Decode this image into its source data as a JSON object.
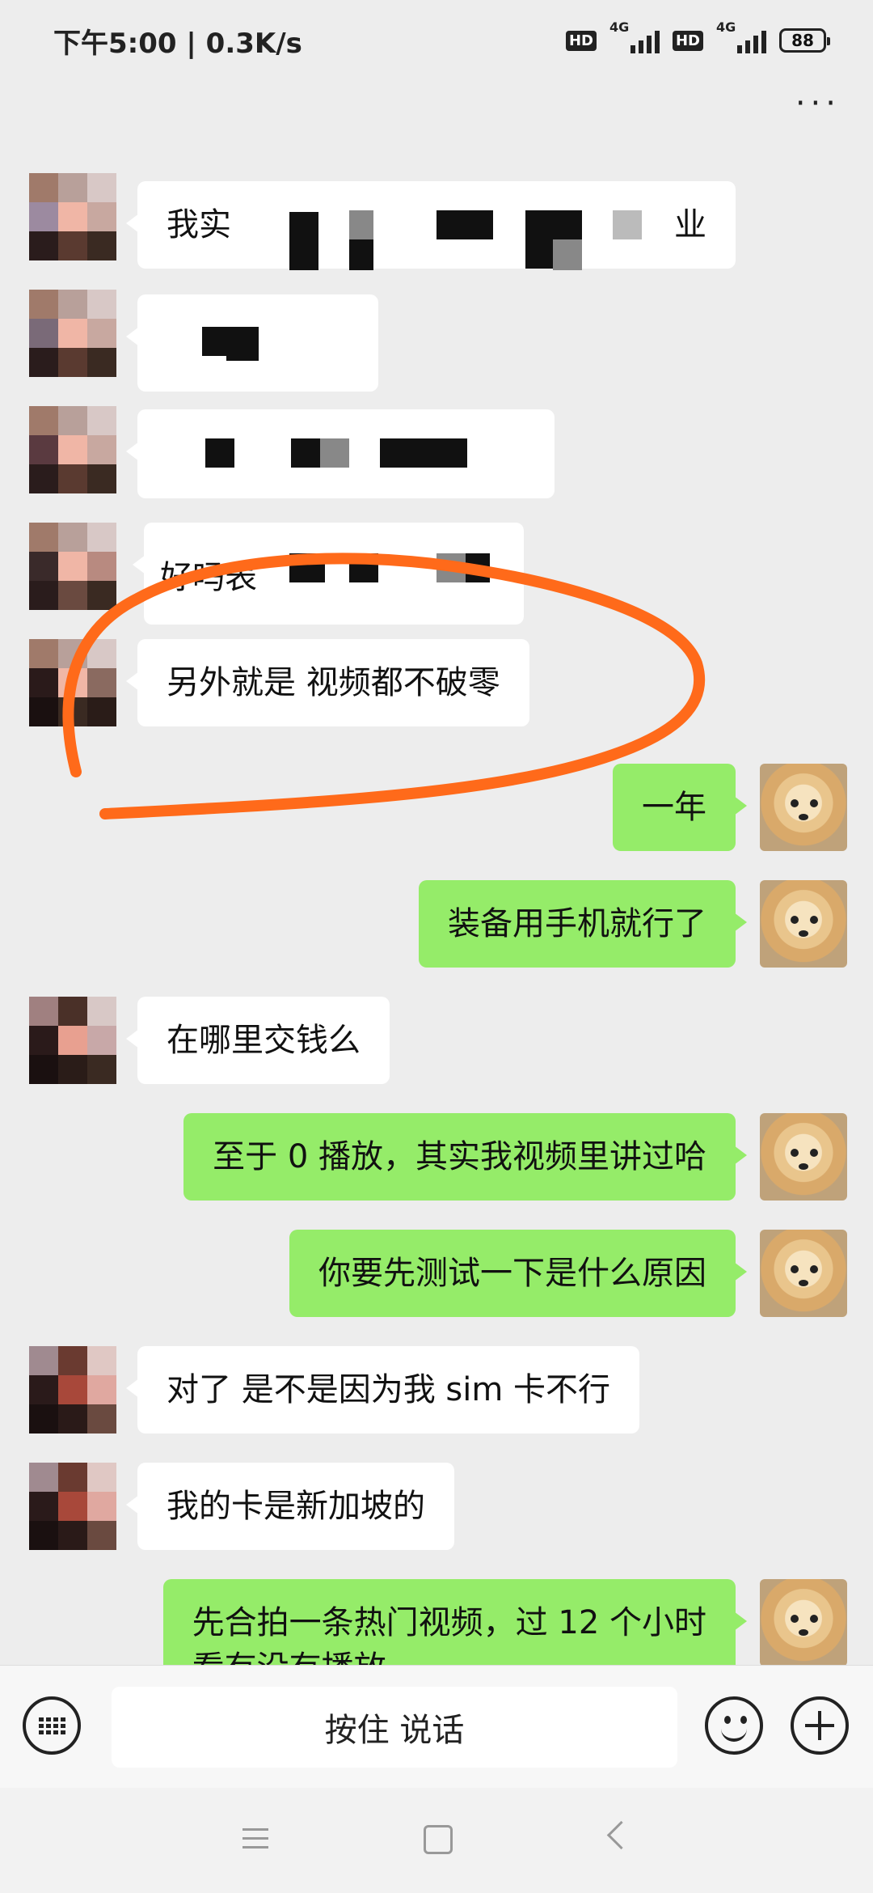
{
  "status_bar": {
    "time_speed": "下午5:00 | 0.3K/s",
    "hd_label": "HD",
    "network_label": "4G",
    "battery": "88"
  },
  "header": {
    "more_icon": "more-dots-icon",
    "more_glyph": "···"
  },
  "messages": [
    {
      "side": "in",
      "text": "我实",
      "suffix": "业",
      "redacted": true
    },
    {
      "side": "in",
      "text": "",
      "redacted": true
    },
    {
      "side": "in",
      "text": "",
      "redacted": true
    },
    {
      "side": "in",
      "text": "好吗表",
      "redacted": true
    },
    {
      "side": "in",
      "text": "另外就是 视频都不破零"
    },
    {
      "side": "out",
      "text": "一年"
    },
    {
      "side": "out",
      "text": "装备用手机就行了"
    },
    {
      "side": "in",
      "text": "在哪里交钱么"
    },
    {
      "side": "out",
      "text": "至于 0 播放，其实我视频里讲过哈"
    },
    {
      "side": "out",
      "text": "你要先测试一下是什么原因"
    },
    {
      "side": "in",
      "text": "对了 是不是因为我 sim 卡不行"
    },
    {
      "side": "in",
      "text": "我的卡是新加坡的"
    },
    {
      "side": "out",
      "text": "先合拍一条热门视频，过 12 个小时",
      "text2": "看有没有播放"
    }
  ],
  "input_bar": {
    "voice_keyboard_icon": "keyboard-icon",
    "hold_to_talk": "按住 说话",
    "emoji_icon": "emoji-icon",
    "more_icon": "plus-icon"
  },
  "nav_bar": {
    "menu_icon": "menu-icon",
    "home_icon": "home-icon",
    "back_icon": "back-icon"
  },
  "colors": {
    "background": "#ededed",
    "incoming": "#ffffff",
    "outgoing": "#95ec69",
    "annotation": "#ff6a1a"
  }
}
